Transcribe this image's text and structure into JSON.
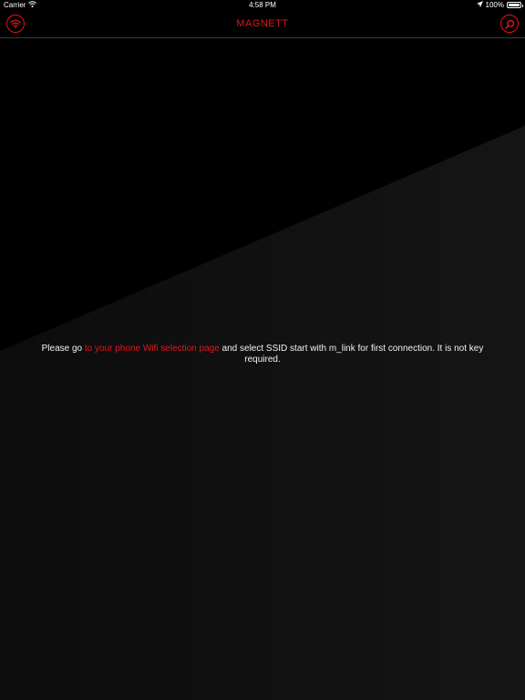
{
  "status_bar": {
    "carrier": "Carrier",
    "time": "4:58 PM",
    "battery": "100%",
    "battery_level": 1.0
  },
  "nav": {
    "title": "MAGNETT",
    "left_icon": "wifi-icon",
    "right_icon": "search-icon"
  },
  "message": {
    "prefix": "Please go ",
    "link_text": "to your phone Wifi selection page",
    "suffix": " and select SSID start with m_link for first connection. It is not key required."
  },
  "colors": {
    "accent": "#e0161b",
    "background": "#000000",
    "text": "#f2f2f2"
  }
}
